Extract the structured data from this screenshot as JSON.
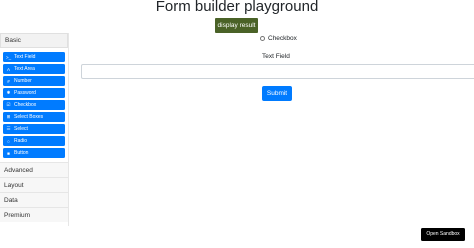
{
  "title": "Form builder playground",
  "display_result_label": "display result",
  "sidebar": {
    "basic_label": "Basic",
    "components": [
      {
        "label": "Text Field",
        "icon": "terminal-icon"
      },
      {
        "label": "Text Area",
        "icon": "font-icon"
      },
      {
        "label": "Number",
        "icon": "hashtag-icon"
      },
      {
        "label": "Password",
        "icon": "asterisk-icon"
      },
      {
        "label": "Checkbox",
        "icon": "check-square-icon"
      },
      {
        "label": "Select Boxes",
        "icon": "plus-square-icon"
      },
      {
        "label": "Select",
        "icon": "list-icon"
      },
      {
        "label": "Radio",
        "icon": "circle-icon"
      },
      {
        "label": "Button",
        "icon": "stop-icon"
      }
    ],
    "categories": [
      "Advanced",
      "Layout",
      "Data",
      "Premium"
    ]
  },
  "form": {
    "checkbox_label": "Checkbox",
    "textfield_label": "Text Field",
    "textfield_value": "",
    "submit_label": "Submit"
  },
  "open_sandbox_label": "Open Sandbox",
  "colors": {
    "primary": "#007bff",
    "display_result_bg": "#4a6227",
    "sandbox_bg": "#000000"
  }
}
